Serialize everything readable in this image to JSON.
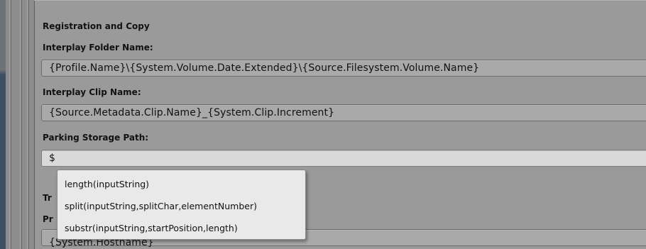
{
  "section": {
    "title": "Registration and Copy"
  },
  "fields": [
    {
      "label": "Interplay Folder Name:",
      "value": "{Profile.Name}\\{System.Volume.Date.Extended}\\{Source.Filesystem.Volume.Name}"
    },
    {
      "label": "Interplay Clip Name:",
      "value": "{Source.Metadata.Clip.Name}_{System.Clip.Increment}"
    },
    {
      "label": "Parking Storage Path:",
      "value": "$"
    }
  ],
  "obscured": {
    "section_title_fragment": "Tr",
    "label_fragment": "Pr",
    "value_fragment": "{System.Hostname}"
  },
  "autocomplete": {
    "items": [
      "length(inputString)",
      "split(inputString,splitChar,elementNumber)",
      "substr(inputString,startPosition,length)"
    ]
  }
}
